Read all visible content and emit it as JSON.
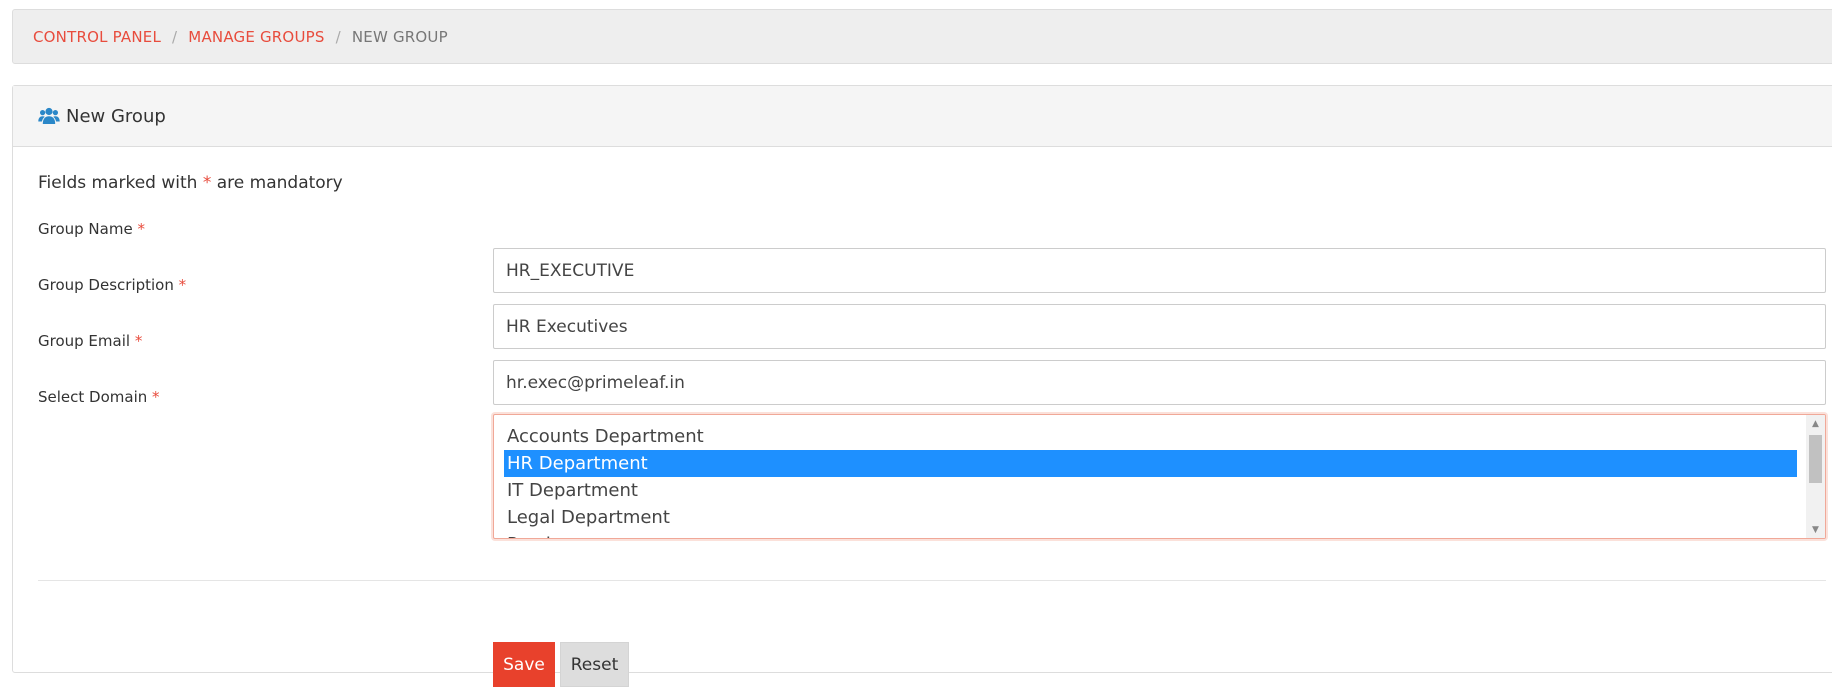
{
  "breadcrumb": {
    "items": [
      {
        "label": "CONTROL PANEL"
      },
      {
        "label": "MANAGE GROUPS"
      },
      {
        "label": "NEW GROUP"
      }
    ],
    "separator": "/"
  },
  "panel": {
    "title": "New Group",
    "icon": "users-icon"
  },
  "form": {
    "mandatory_note_prefix": "Fields marked with",
    "mandatory_marker": "*",
    "mandatory_note_suffix": "are mandatory",
    "group_name": {
      "label": "Group Name",
      "value": "HR_EXECUTIVE"
    },
    "group_description": {
      "label": "Group Description",
      "value": "HR Executives"
    },
    "group_email": {
      "label": "Group Email",
      "value": "hr.exec@primeleaf.in"
    },
    "domain": {
      "label": "Select Domain",
      "options": [
        "Accounts Department",
        "HR Department",
        "IT Department",
        "Legal Department",
        "Purchase"
      ],
      "selected": "HR Department"
    }
  },
  "buttons": {
    "save_label": "Save",
    "reset_label": "Reset"
  },
  "colors": {
    "accent": "#e84c3d",
    "selected_option": "#1e90ff",
    "icon": "#2a87c8"
  }
}
